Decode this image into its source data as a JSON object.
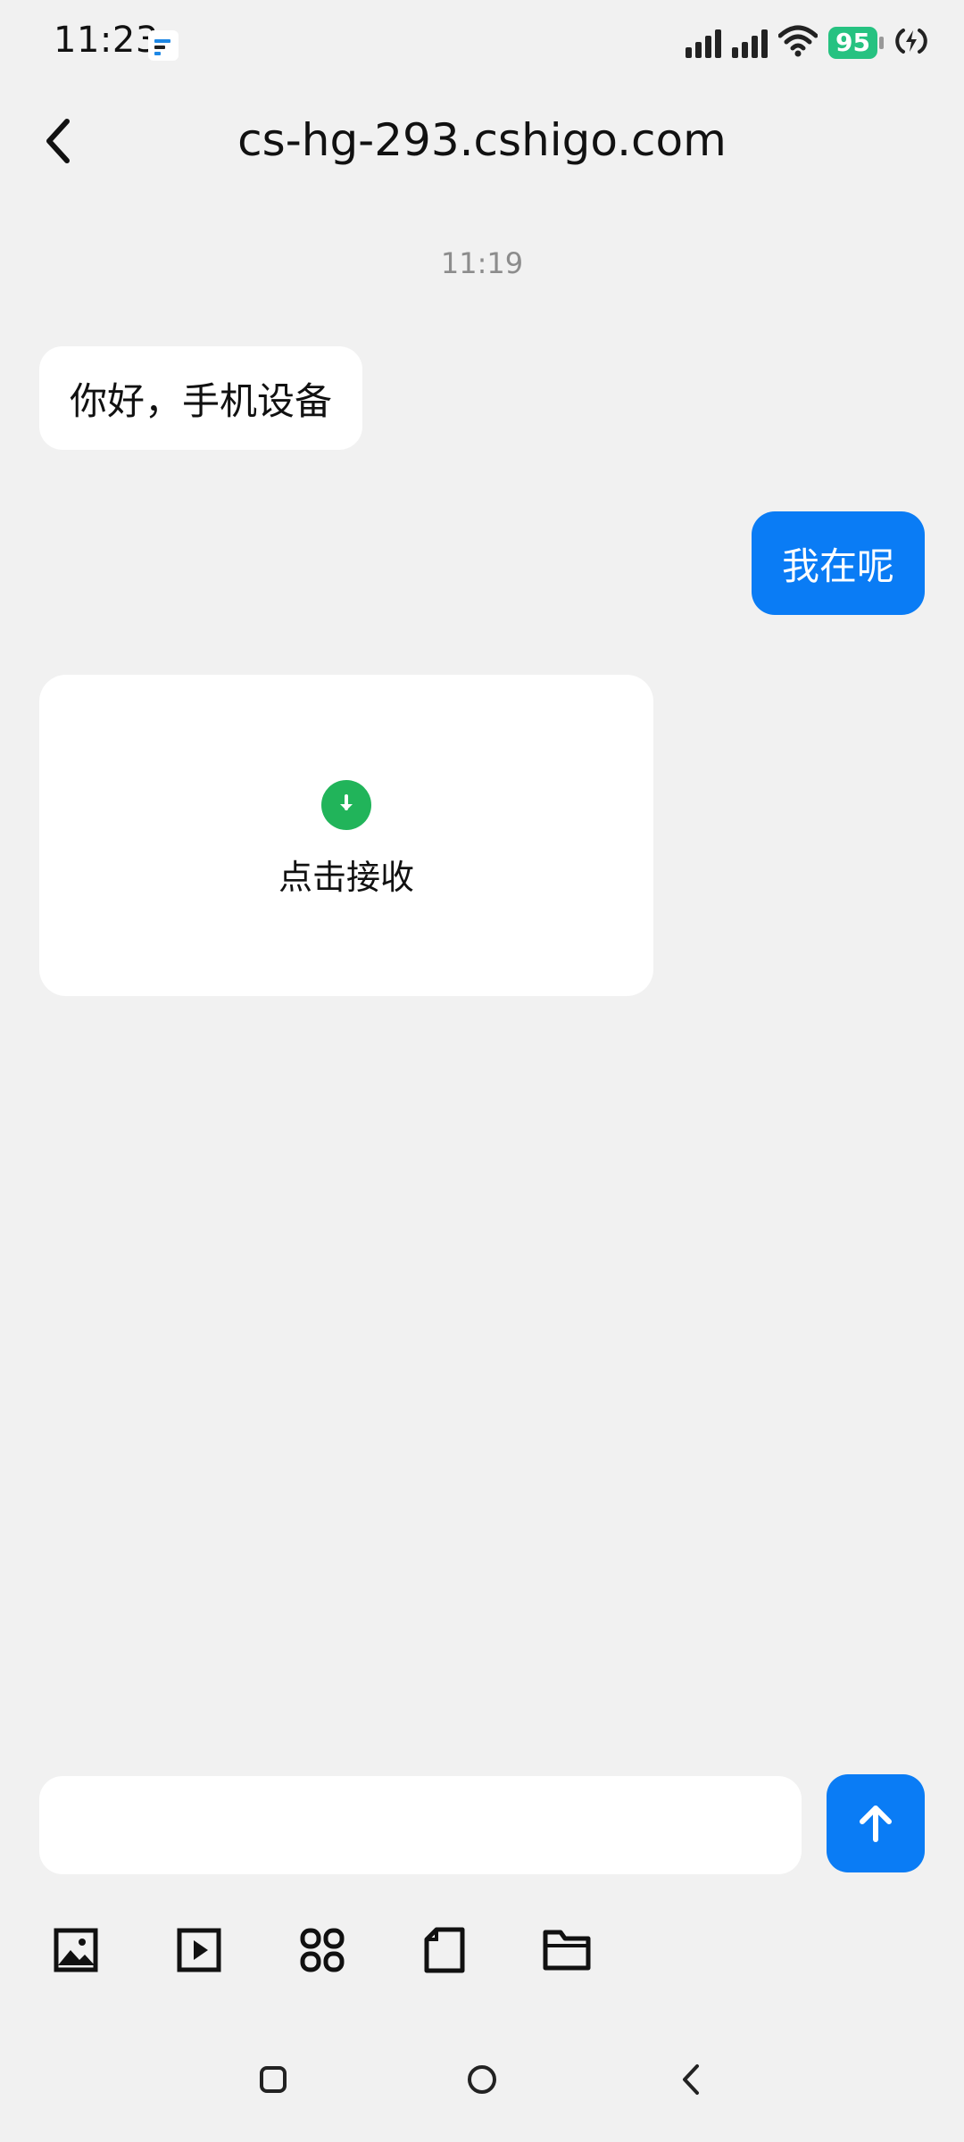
{
  "status_bar": {
    "time": "11:23",
    "battery": "95",
    "icons": [
      "app-notification-icon",
      "signal-icon",
      "signal-icon",
      "wifi-icon",
      "battery-icon",
      "charging-icon"
    ],
    "battery_color": "#26c281"
  },
  "header": {
    "title": "cs-hg-293.cshigo.com",
    "back_icon": "chevron-left-icon"
  },
  "chat": {
    "timestamp": "11:19",
    "messages": [
      {
        "side": "left",
        "text": "你好，手机设备"
      },
      {
        "side": "right",
        "text": "我在呢"
      }
    ],
    "file_card": {
      "icon": "download-icon",
      "label": "点击接收",
      "icon_color": "#21b45a"
    }
  },
  "composer": {
    "value": "",
    "send_icon": "arrow-up-icon",
    "accent_color": "#0a7cf5"
  },
  "toolbar": {
    "items": [
      "image-icon",
      "video-icon",
      "apps-icon",
      "file-icon",
      "folder-icon"
    ]
  },
  "nav": {
    "items": [
      "recents-icon",
      "home-icon",
      "back-icon"
    ]
  }
}
